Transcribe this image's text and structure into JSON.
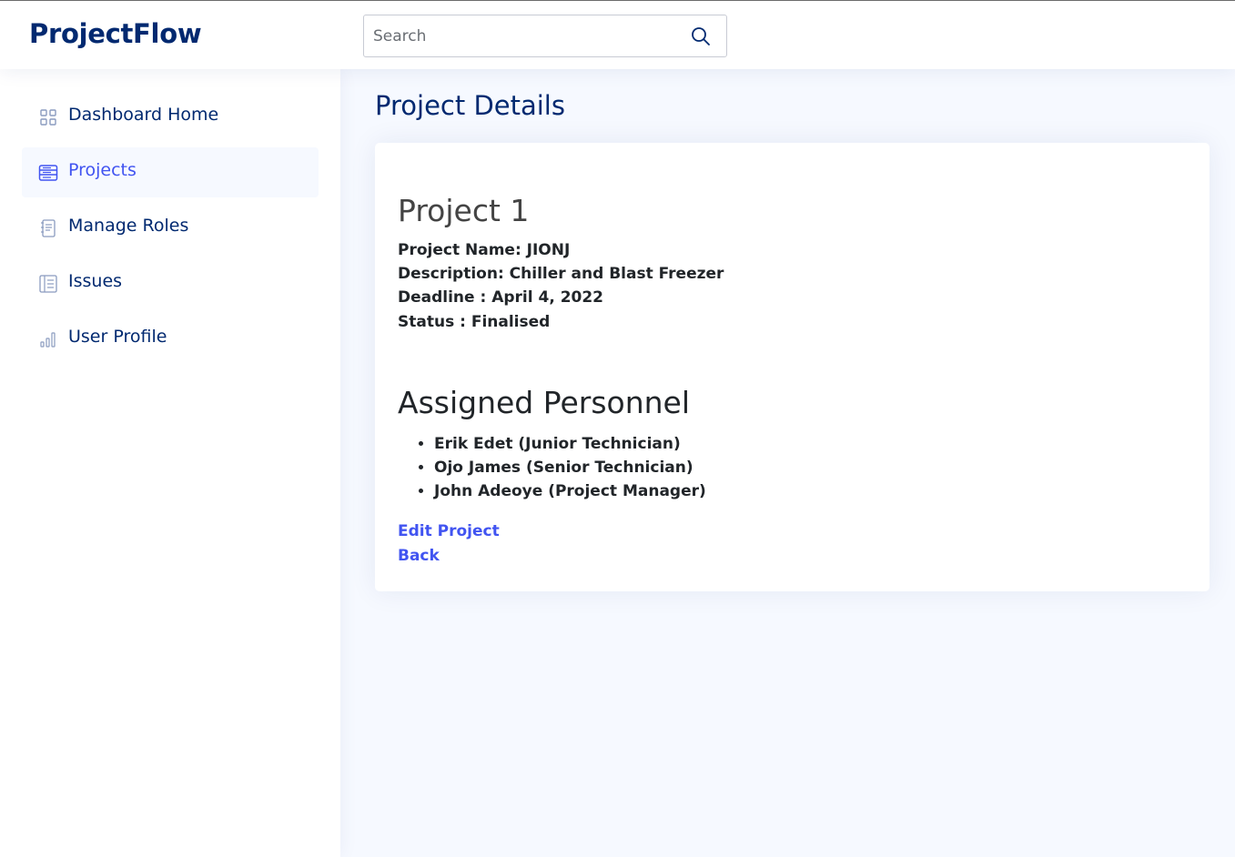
{
  "header": {
    "brand": "ProjectFlow",
    "search_placeholder": "Search",
    "search_value": ""
  },
  "sidebar": {
    "items": [
      {
        "label": "Dashboard Home",
        "icon": "grid-icon",
        "active": false
      },
      {
        "label": "Projects",
        "icon": "layout-text-window-icon",
        "active": true
      },
      {
        "label": "Manage Roles",
        "icon": "journal-text-icon",
        "active": false
      },
      {
        "label": "Issues",
        "icon": "layout-text-sidebar-icon",
        "active": false
      },
      {
        "label": "User Profile",
        "icon": "bar-chart-icon",
        "active": false
      }
    ]
  },
  "main": {
    "page_title": "Project Details",
    "project": {
      "title": "Project 1",
      "name_line": "Project Name: JIONJ",
      "description_line": "Description: Chiller and Blast Freezer",
      "deadline_line": "Deadline : April 4, 2022",
      "status_line": "Status : Finalised"
    },
    "personnel": {
      "title": "Assigned Personnel",
      "members": [
        "Erik Edet (Junior Technician)",
        "Ojo James (Senior Technician)",
        "John Adeoye (Project Manager)"
      ]
    },
    "actions": {
      "edit_label": "Edit Project",
      "back_label": "Back"
    }
  },
  "colors": {
    "brand": "#012970",
    "accent": "#4154f1",
    "page_background": "#f6f9ff",
    "text_dark": "#212529"
  }
}
